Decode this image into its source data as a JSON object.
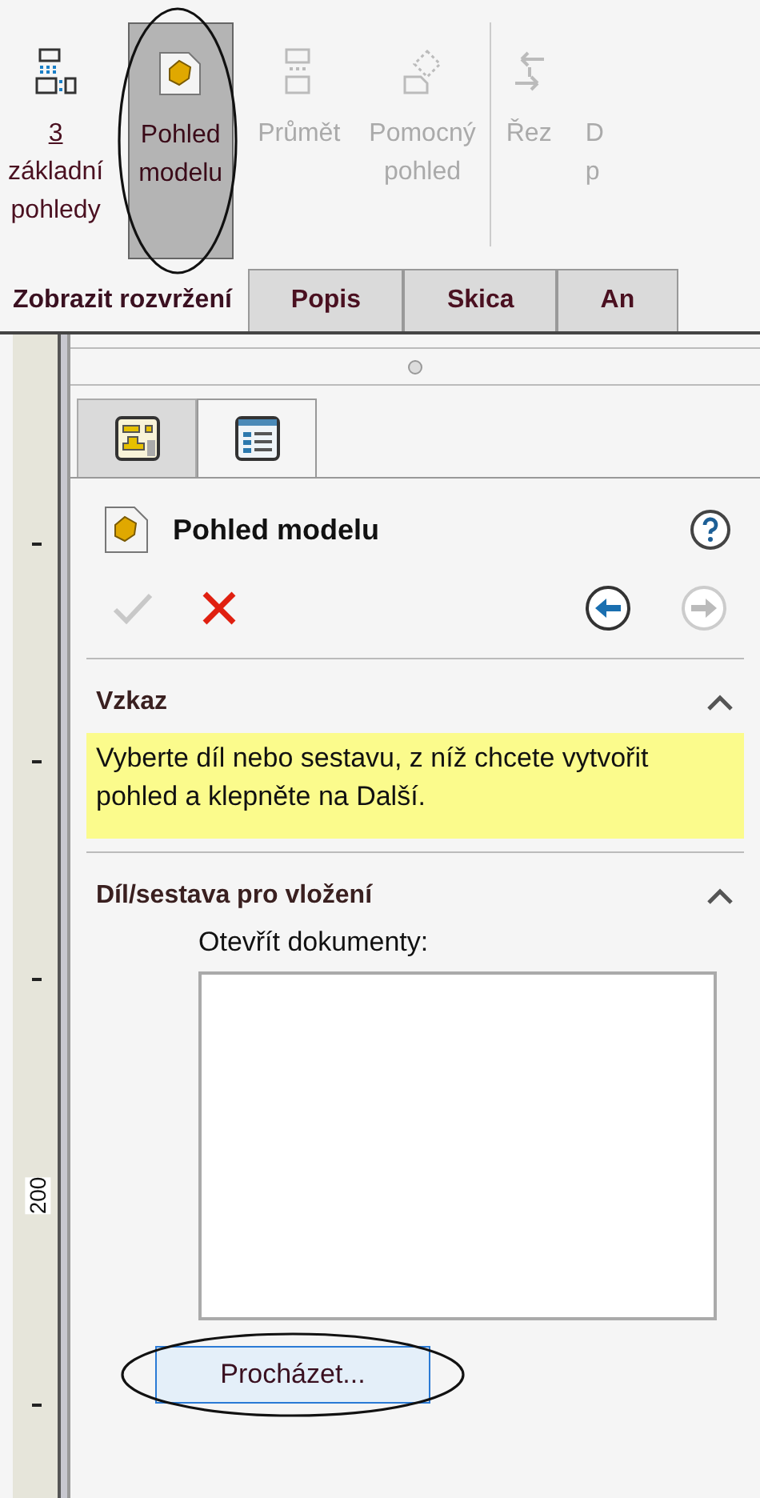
{
  "ribbon": {
    "buttons": [
      {
        "kind": "standard-views",
        "lines": [
          "3",
          "základní",
          "pohledy"
        ],
        "selected": false,
        "disabled": false,
        "circled": false
      },
      {
        "kind": "model-view",
        "lines": [
          "Pohled",
          "modelu"
        ],
        "selected": true,
        "disabled": false,
        "circled": true
      },
      {
        "kind": "projected",
        "lines": [
          "Průmět"
        ],
        "selected": false,
        "disabled": true,
        "circled": false
      },
      {
        "kind": "auxiliary",
        "lines": [
          "Pomocný",
          "pohled"
        ],
        "selected": false,
        "disabled": true,
        "circled": false
      },
      {
        "kind": "separator"
      },
      {
        "kind": "section",
        "lines": [
          "Řez"
        ],
        "selected": false,
        "disabled": true,
        "circled": false
      },
      {
        "kind": "cut",
        "lines": [
          "D",
          "p"
        ],
        "selected": false,
        "disabled": true,
        "circled": false
      }
    ]
  },
  "tabs": [
    {
      "label": "Zobrazit rozvržení",
      "selected": true
    },
    {
      "label": "Popis",
      "selected": false
    },
    {
      "label": "Skica",
      "selected": false
    },
    {
      "label": "An",
      "selected": false
    }
  ],
  "ruler": {
    "label": "200"
  },
  "panel": {
    "tabs": [
      {
        "kind": "feature-manager",
        "selected": false
      },
      {
        "kind": "property-manager",
        "selected": true
      }
    ],
    "title": "Pohled modelu",
    "actions": {
      "ok_disabled": true,
      "next_disabled": true
    },
    "sections": [
      {
        "kind": "message",
        "title": "Vzkaz",
        "expanded": true,
        "text": "Vyberte díl nebo sestavu, z níž chcete vytvořit pohled a klepněte na Další."
      },
      {
        "kind": "documents",
        "title": "Díl/sestava pro vložení",
        "expanded": true,
        "label": "Otevřít dokumenty:",
        "button": {
          "label": "Procházet...",
          "circled": true
        }
      }
    ]
  }
}
